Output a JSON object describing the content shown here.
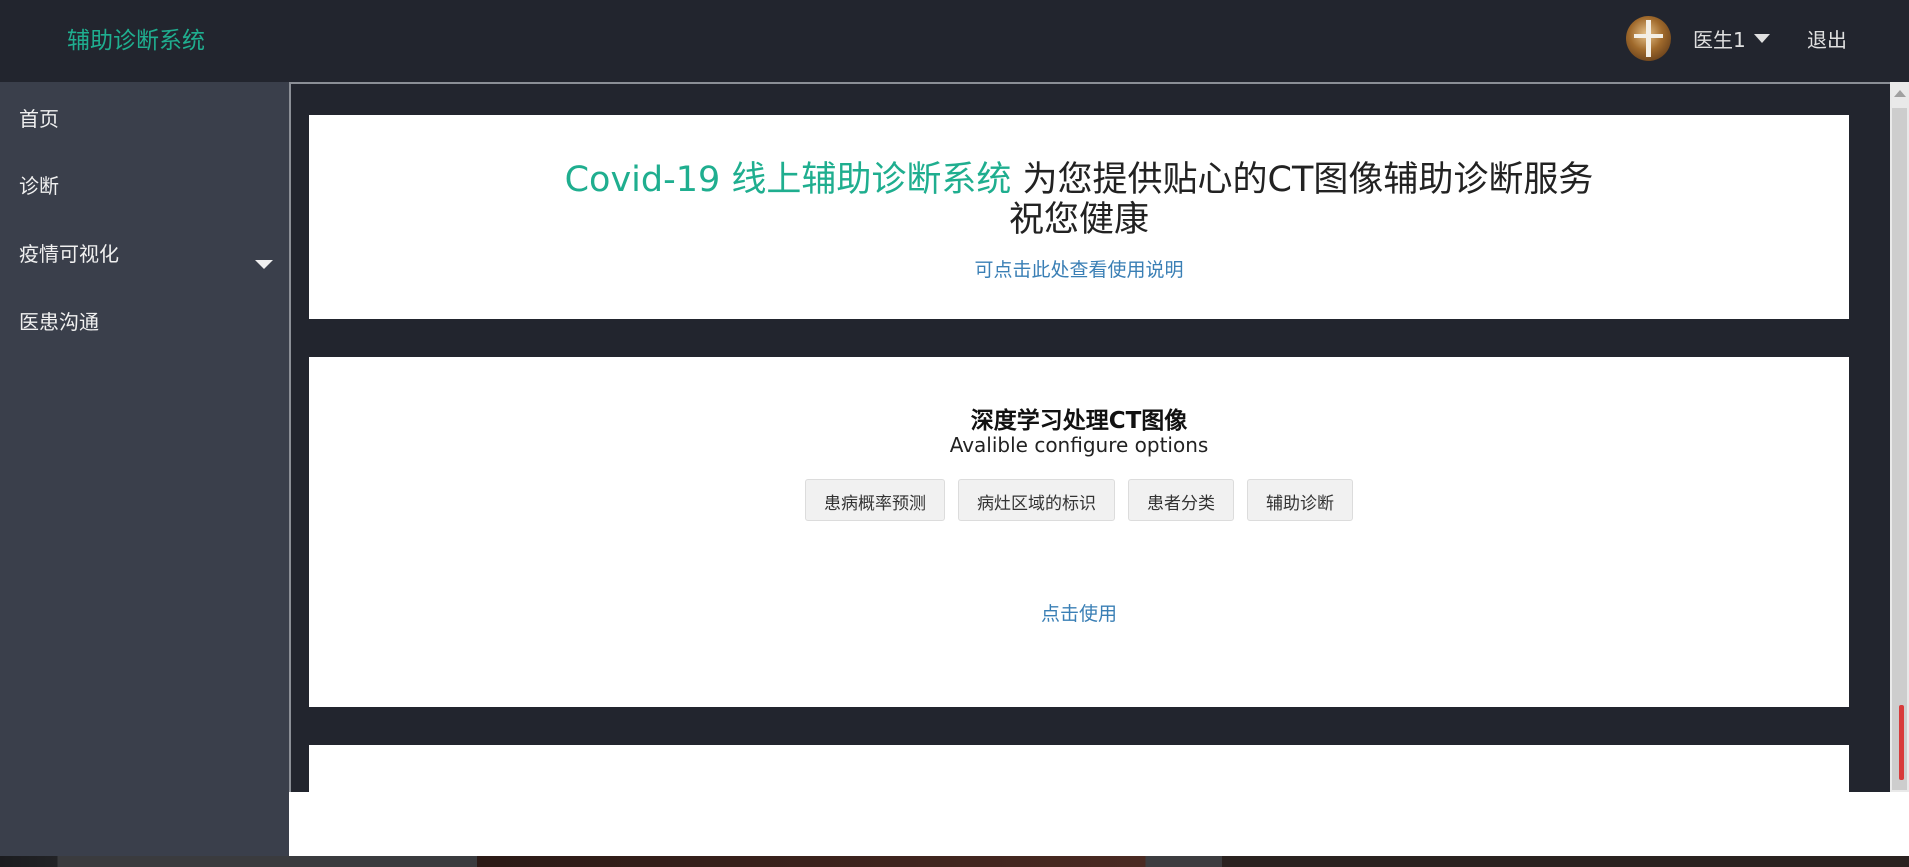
{
  "app": {
    "brand": "辅助诊断系统"
  },
  "header": {
    "user_label": "医生1",
    "logout_label": "退出"
  },
  "sidebar": {
    "items": [
      {
        "label": "首页"
      },
      {
        "label": "诊断"
      },
      {
        "label": "疫情可视化"
      },
      {
        "label": "医患沟通"
      }
    ]
  },
  "intro": {
    "headline_highlight": "Covid-19 线上辅助诊断系统",
    "headline_rest": " 为您提供贴心的CT图像辅助诊断服务",
    "headline_line2": "祝您健康",
    "help_link": "可点击此处查看使用说明"
  },
  "deep_learning": {
    "title": "深度学习处理CT图像",
    "subtitle": "Avalible configure options",
    "options": [
      "患病概率预测",
      "病灶区域的标识",
      "患者分类",
      "辅助诊断"
    ],
    "use_link": "点击使用"
  },
  "colors": {
    "topbar": "#22252e",
    "sidebar": "#3a3f4b",
    "accent": "#1fae8f",
    "link": "#3a7fb5"
  }
}
